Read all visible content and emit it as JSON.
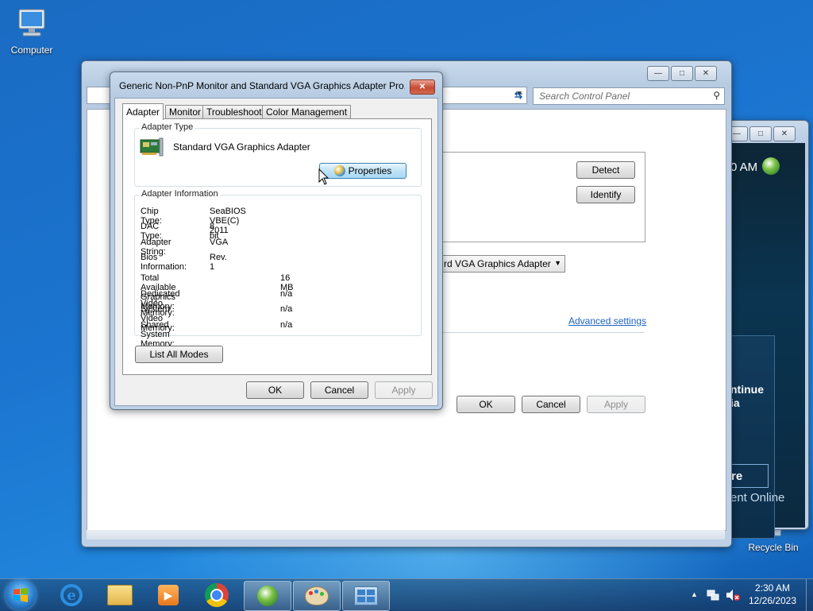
{
  "desktop": {
    "computer_label": "Computer",
    "recycle_label": "Recycle Bin"
  },
  "control_panel": {
    "search_placeholder": "Search Control Panel",
    "detect_label": "Detect",
    "identify_label": "Identify",
    "display_select_value": "rd VGA Graphics Adapter",
    "advanced_link": "Advanced settings",
    "ok_label": "OK",
    "cancel_label": "Cancel",
    "apply_label": "Apply"
  },
  "gs_window": {
    "time_fragment": "0 AM",
    "text_line1": "ntinue",
    "text_line2": "ia",
    "button_fragment": "re",
    "link_fragment": "ent Online"
  },
  "dialog": {
    "title": "Generic Non-PnP Monitor and Standard VGA Graphics Adapter Pro...",
    "tabs": [
      {
        "label": "Adapter"
      },
      {
        "label": "Monitor"
      },
      {
        "label": "Troubleshoot"
      },
      {
        "label": "Color Management"
      }
    ],
    "adapter_type_group": "Adapter Type",
    "adapter_name": "Standard VGA Graphics Adapter",
    "properties_label": "Properties",
    "adapter_info_group": "Adapter Information",
    "info": [
      {
        "key": "Chip Type:",
        "value": "SeaBIOS VBE(C) 2011"
      },
      {
        "key": "DAC Type:",
        "value": "8 bit"
      },
      {
        "key": "Adapter String:",
        "value": "VGA"
      },
      {
        "key": "Bios Information:",
        "value": "Rev. 1"
      }
    ],
    "memory": [
      {
        "key": "Total Available Graphics Memory:",
        "value": "16 MB"
      },
      {
        "key": "Dedicated Video Memory:",
        "value": "n/a"
      },
      {
        "key": "System Video Memory:",
        "value": "n/a"
      },
      {
        "key": "Shared System Memory:",
        "value": "n/a"
      }
    ],
    "list_modes_label": "List All Modes",
    "ok_label": "OK",
    "cancel_label": "Cancel",
    "apply_label": "Apply"
  },
  "taskbar": {
    "time": "2:30 AM",
    "date": "12/26/2023"
  }
}
